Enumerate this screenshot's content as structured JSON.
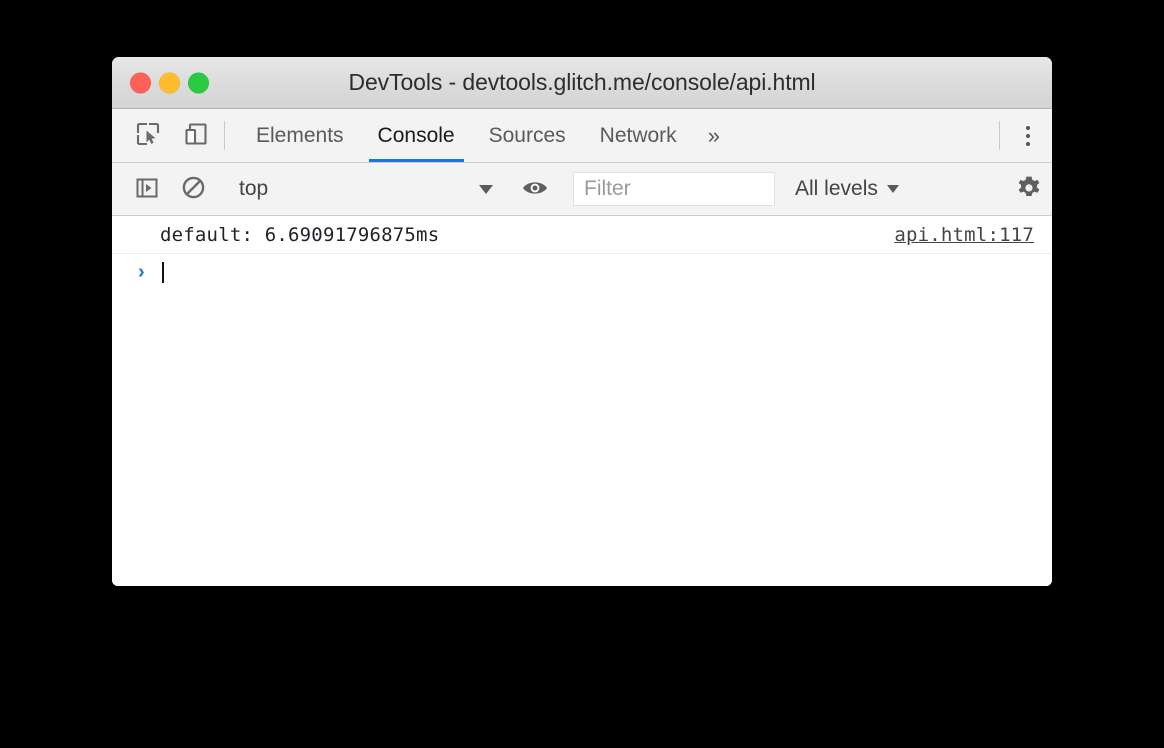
{
  "window": {
    "title": "DevTools - devtools.glitch.me/console/api.html",
    "controls": {
      "close": "close-button",
      "minimize": "minimize-button",
      "zoom": "zoom-button"
    }
  },
  "tabbar": {
    "inspect_icon": "inspect-element-icon",
    "device_icon": "device-toolbar-icon",
    "tabs": [
      {
        "label": "Elements",
        "active": false
      },
      {
        "label": "Console",
        "active": true
      },
      {
        "label": "Sources",
        "active": false
      },
      {
        "label": "Network",
        "active": false
      }
    ],
    "overflow_label": "»",
    "more_icon": "more-options-icon"
  },
  "console_toolbar": {
    "sidebar_icon": "console-sidebar-toggle-icon",
    "clear_icon": "clear-console-icon",
    "context": {
      "value": "top",
      "caret": "chevron-down-icon"
    },
    "eye_icon": "live-expression-eye-icon",
    "filter": {
      "value": "",
      "placeholder": "Filter"
    },
    "levels": {
      "value": "All levels",
      "caret": "chevron-down-icon"
    },
    "settings_icon": "settings-gear-icon"
  },
  "console": {
    "messages": [
      {
        "text": "default: 6.69091796875ms",
        "source": "api.html:117"
      }
    ],
    "prompt": {
      "arrow": "›",
      "value": ""
    }
  },
  "colors": {
    "accent_blue": "#1a73e8",
    "traffic_red": "#ff6159",
    "traffic_yellow": "#ffbd2e",
    "traffic_green": "#2acb42",
    "toolbar_bg": "#f3f3f3",
    "titlebar_bg": "#dcdcdc",
    "body_bg": "#ffffff",
    "page_bg": "#000000"
  }
}
